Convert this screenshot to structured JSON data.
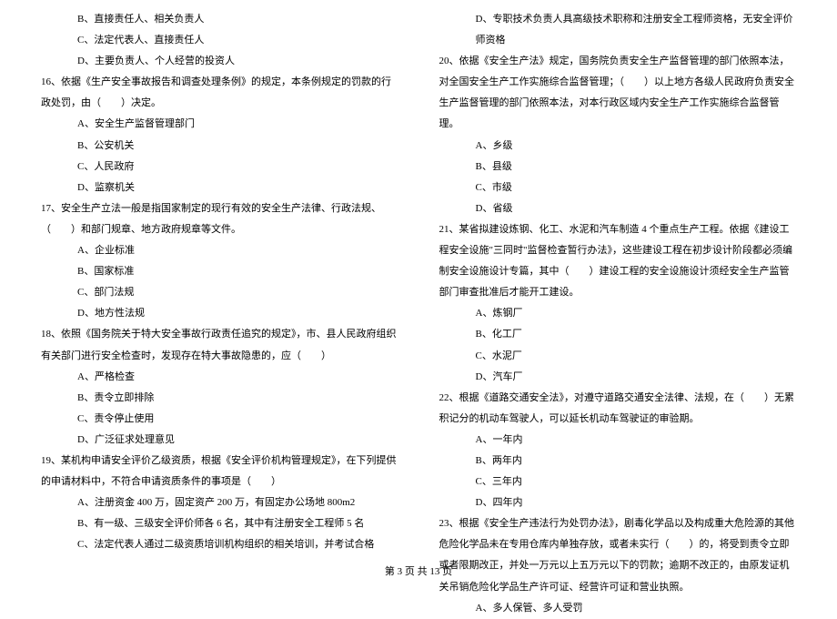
{
  "left_column": {
    "q15_options": {
      "b": "B、直接责任人、相关负责人",
      "c": "C、法定代表人、直接责任人",
      "d": "D、主要负责人、个人经营的投资人"
    },
    "q16": {
      "text": "16、依据《生产安全事故报告和调查处理条例》的规定，本条例规定的罚款的行政处罚，由（　　）决定。",
      "a": "A、安全生产监督管理部门",
      "b": "B、公安机关",
      "c": "C、人民政府",
      "d": "D、监察机关"
    },
    "q17": {
      "text": "17、安全生产立法一般是指国家制定的现行有效的安全生产法律、行政法规、（　　）和部门规章、地方政府规章等文件。",
      "a": "A、企业标准",
      "b": "B、国家标准",
      "c": "C、部门法规",
      "d": "D、地方性法规"
    },
    "q18": {
      "text": "18、依照《国务院关于特大安全事故行政责任追究的规定》，市、县人民政府组织有关部门进行安全检查时，发现存在特大事故隐患的，应（　　）",
      "a": "A、严格检查",
      "b": "B、责令立即排除",
      "c": "C、责令停止使用",
      "d": "D、广泛征求处理意见"
    },
    "q19": {
      "text": "19、某机构申请安全评价乙级资质，根据《安全评价机构管理规定》，在下列提供的申请材料中，不符合申请资质条件的事项是（　　）",
      "a": "A、注册资金 400 万，固定资产 200 万，有固定办公场地 800m2",
      "b": "B、有一级、三级安全评价师各 6 名，其中有注册安全工程师 5 名",
      "c": "C、法定代表人通过二级资质培训机构组织的相关培训，并考试合格"
    }
  },
  "right_column": {
    "q19_d": "D、专职技术负责人具高级技术职称和注册安全工程师资格，无安全评价师资格",
    "q20": {
      "text": "20、依据《安全生产法》规定，国务院负责安全生产监督管理的部门依照本法，对全国安全生产工作实施综合监督管理；（　　）以上地方各级人民政府负责安全生产监督管理的部门依照本法，对本行政区域内安全生产工作实施综合监督管理。",
      "a": "A、乡级",
      "b": "B、县级",
      "c": "C、市级",
      "d": "D、省级"
    },
    "q21": {
      "text": "21、某省拟建设炼钢、化工、水泥和汽车制造 4 个重点生产工程。依据《建设工程安全设施\"三同时\"监督检查暂行办法》，这些建设工程在初步设计阶段都必须编制安全设施设计专篇，其中（　　）建设工程的安全设施设计须经安全生产监管部门审查批准后才能开工建设。",
      "a": "A、炼钢厂",
      "b": "B、化工厂",
      "c": "C、水泥厂",
      "d": "D、汽车厂"
    },
    "q22": {
      "text": "22、根据《道路交通安全法》，对遵守道路交通安全法律、法规，在（　　）无累积记分的机动车驾驶人，可以延长机动车驾驶证的审验期。",
      "a": "A、一年内",
      "b": "B、两年内",
      "c": "C、三年内",
      "d": "D、四年内"
    },
    "q23": {
      "text": "23、根据《安全生产违法行为处罚办法》，剧毒化学品以及构成重大危险源的其他危险化学品未在专用仓库内单独存放，或者未实行（　　）的，将受到责令立即或者限期改正，并处一万元以上五万元以下的罚款；逾期不改正的，由原发证机关吊销危险化学品生产许可证、经营许可证和营业执照。",
      "a": "A、多人保管、多人受罚"
    }
  },
  "footer": "第 3 页 共 13 页"
}
